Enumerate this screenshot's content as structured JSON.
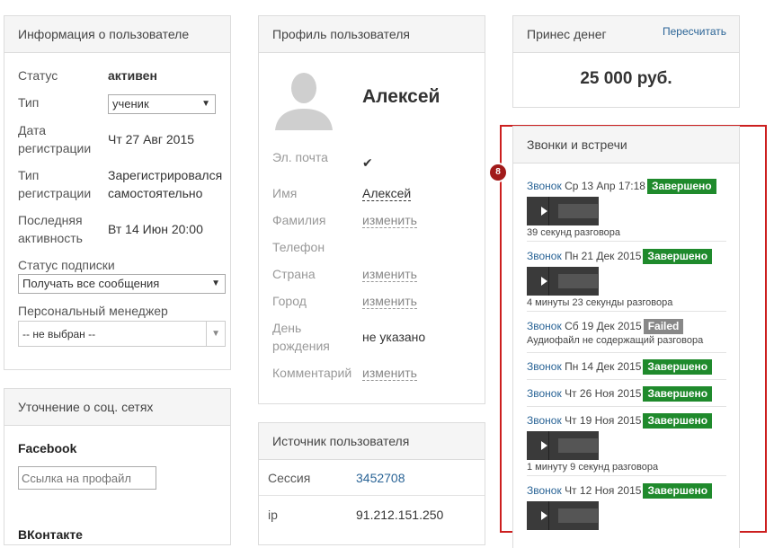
{
  "user_info": {
    "title": "Информация о пользователе",
    "status_label": "Статус",
    "status_value": "активен",
    "type_label": "Тип",
    "type_value": "ученик",
    "reg_date_label_1": "Дата",
    "reg_date_label_2": "регистрации",
    "reg_date_value": "Чт 27 Авг 2015",
    "reg_type_label_1": "Тип",
    "reg_type_label_2": "регистрации",
    "reg_type_value_1": "Зарегистрировался",
    "reg_type_value_2": "самостоятельно",
    "last_active_label_1": "Последняя",
    "last_active_label_2": "активность",
    "last_active_value": "Вт 14 Июн 20:00",
    "subscription_label": "Статус подписки",
    "subscription_value": "Получать все сообщения",
    "manager_label": "Персональный менеджер",
    "manager_value": "-- не выбран --"
  },
  "social": {
    "title": "Уточнение о соц. сетях",
    "facebook_label": "Facebook",
    "facebook_placeholder": "Ссылка на профайл",
    "vk_label": "ВКонтакте"
  },
  "profile": {
    "title": "Профиль пользователя",
    "name": "Алексей",
    "email_label": "Эл. почта",
    "first_name_label": "Имя",
    "first_name_value": "Алексей",
    "last_name_label": "Фамилия",
    "last_name_value": "изменить",
    "phone_label": "Телефон",
    "country_label": "Страна",
    "country_value": "изменить",
    "city_label": "Город",
    "city_value": "изменить",
    "birthday_label_1": "День",
    "birthday_label_2": "рождения",
    "birthday_value": "не указано",
    "comment_label": "Комментарий",
    "comment_value": "изменить"
  },
  "source": {
    "title": "Источник пользователя",
    "session_label": "Сессия",
    "session_value": "3452708",
    "ip_label": "ip",
    "ip_value": "91.212.151.250"
  },
  "money": {
    "title": "Принес денег",
    "recalc": "Пересчитать",
    "amount": "25 000 руб."
  },
  "calls": {
    "title": "Звонки и встречи",
    "marker": "8",
    "items": [
      {
        "link": "Звонок",
        "date": "Ср 13 Апр 17:18",
        "status": "Завершено",
        "sub": "39 секунд разговора"
      },
      {
        "link": "Звонок",
        "date": "Пн 21 Дек 2015",
        "status": "Завершено",
        "sub": "4 минуты 23 секунды разговора"
      },
      {
        "link": "Звонок",
        "date": "Сб 19 Дек 2015",
        "status": "Failed",
        "sub": "Аудиофайл не содержащий разговора"
      },
      {
        "link": "Звонок",
        "date": "Пн 14 Дек 2015",
        "status": "Завершено",
        "sub": ""
      },
      {
        "link": "Звонок",
        "date": "Чт 26 Ноя 2015",
        "status": "Завершено",
        "sub": ""
      },
      {
        "link": "Звонок",
        "date": "Чт 19 Ноя 2015",
        "status": "Завершено",
        "sub": "1 минуту 9 секунд разговора"
      },
      {
        "link": "Звонок",
        "date": "Чт 12 Ноя 2015",
        "status": "Завершено",
        "sub": ""
      }
    ]
  }
}
